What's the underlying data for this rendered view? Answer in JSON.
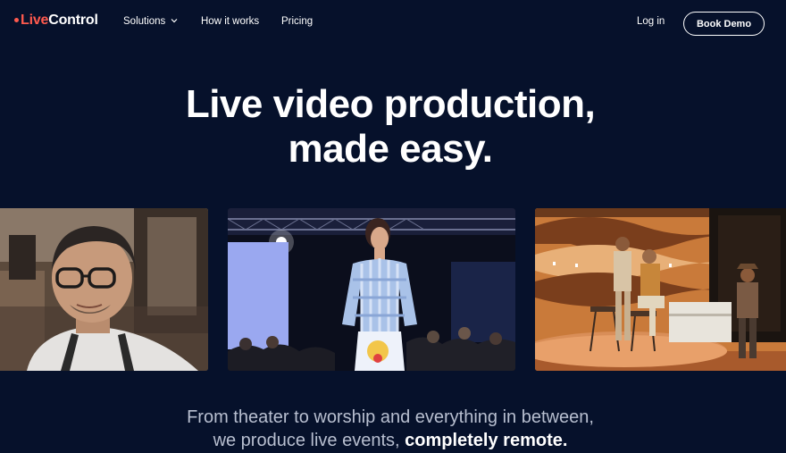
{
  "brand": {
    "name_part1": "Live",
    "name_part2": "Control",
    "accent": "#ff5a4e"
  },
  "nav": {
    "solutions": "Solutions",
    "how_it_works": "How it works",
    "pricing": "Pricing",
    "login": "Log in",
    "book_demo": "Book Demo"
  },
  "hero": {
    "line1": "Live video production,",
    "line2": "made easy."
  },
  "tagline": {
    "line1": "From theater to worship and everything in between,",
    "line2_prefix": "we produce live events, ",
    "line2_bold": "completely remote."
  },
  "colors": {
    "background": "#06112b",
    "text": "#ffffff",
    "muted": "#b8bfd0"
  },
  "icons": {
    "solutions_dropdown": "chevron-down-icon"
  }
}
